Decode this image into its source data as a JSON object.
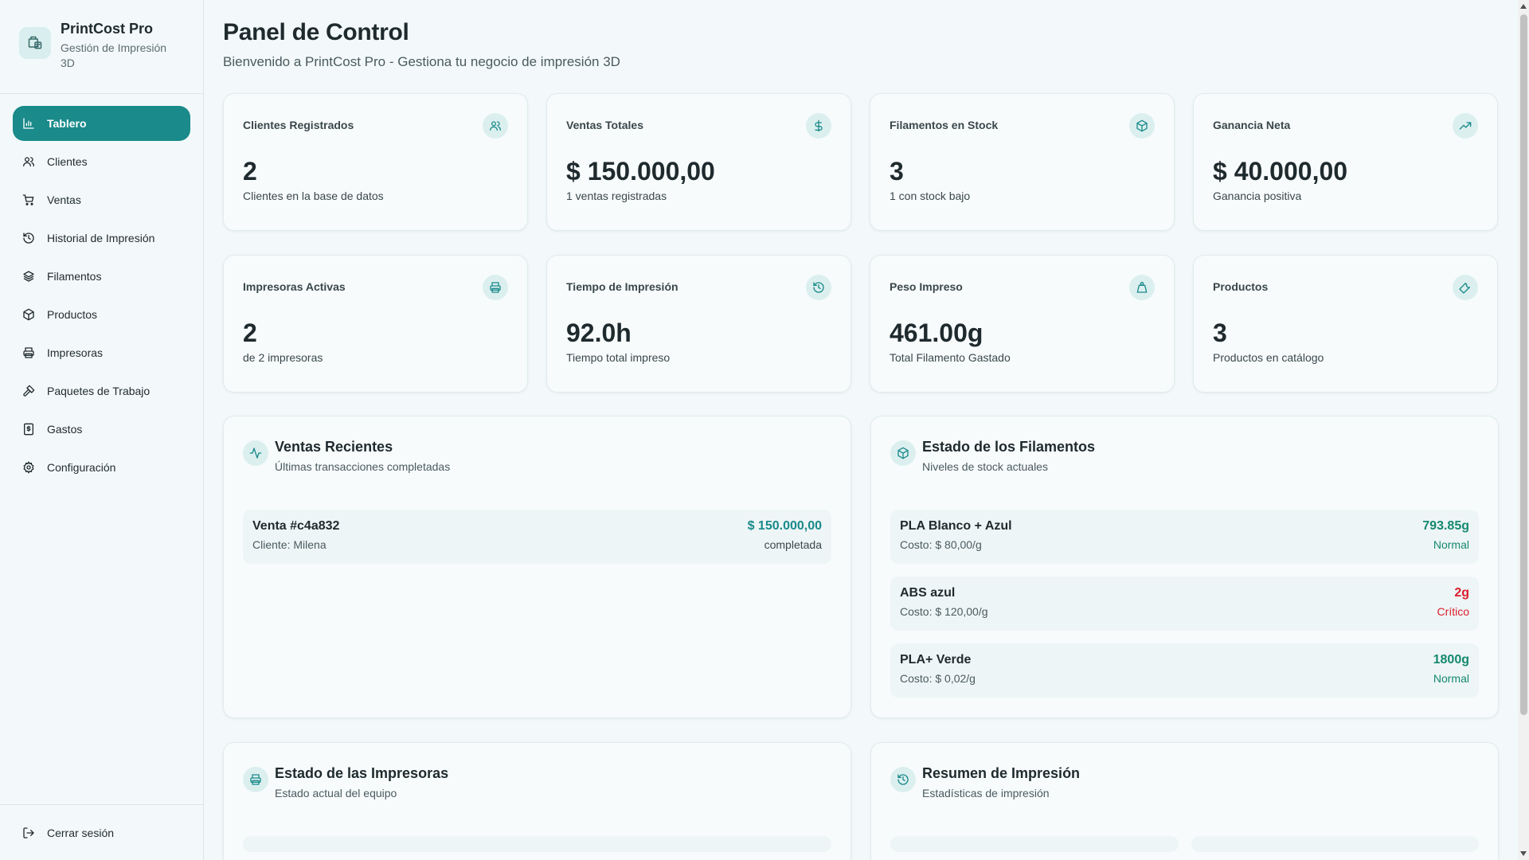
{
  "brand": {
    "title": "PrintCost Pro",
    "subtitle": "Gestión de Impresión 3D"
  },
  "nav": [
    {
      "label": "Tablero",
      "icon": "bar-chart-icon",
      "active": true
    },
    {
      "label": "Clientes",
      "icon": "users-icon"
    },
    {
      "label": "Ventas",
      "icon": "cart-icon"
    },
    {
      "label": "Historial de Impresión",
      "icon": "history-icon"
    },
    {
      "label": "Filamentos",
      "icon": "layers-icon"
    },
    {
      "label": "Productos",
      "icon": "box-icon"
    },
    {
      "label": "Impresoras",
      "icon": "printer-icon"
    },
    {
      "label": "Paquetes de Trabajo",
      "icon": "hammer-icon"
    },
    {
      "label": "Gastos",
      "icon": "receipt-icon"
    },
    {
      "label": "Configuración",
      "icon": "gear-icon"
    }
  ],
  "logout": {
    "label": "Cerrar sesión"
  },
  "header": {
    "title": "Panel de Control",
    "subtitle": "Bienvenido a PrintCost Pro - Gestiona tu negocio de impresión 3D"
  },
  "stats": [
    {
      "label": "Clientes Registrados",
      "value": "2",
      "desc": "Clientes en la base de datos",
      "icon": "users-icon"
    },
    {
      "label": "Ventas Totales",
      "value": "$ 150.000,00",
      "desc": "1 ventas registradas",
      "icon": "dollar-icon"
    },
    {
      "label": "Filamentos en Stock",
      "value": "3",
      "desc": "1 con stock bajo",
      "icon": "box-icon"
    },
    {
      "label": "Ganancia Neta",
      "value": "$ 40.000,00",
      "desc": "Ganancia positiva",
      "icon": "trending-up-icon"
    },
    {
      "label": "Impresoras Activas",
      "value": "2",
      "desc": "de 2 impresoras",
      "icon": "printer-icon"
    },
    {
      "label": "Tiempo de Impresión",
      "value": "92.0h",
      "desc": "Tiempo total impreso",
      "icon": "history-icon"
    },
    {
      "label": "Peso Impreso",
      "value": "461.00g",
      "desc": "Total Filamento Gastado",
      "icon": "weight-icon"
    },
    {
      "label": "Productos",
      "value": "3",
      "desc": "Productos en catálogo",
      "icon": "wrench-icon"
    }
  ],
  "recent_sales": {
    "title": "Ventas Recientes",
    "subtitle": "Últimas transacciones completadas",
    "items": [
      {
        "title": "Venta #c4a832",
        "client": "Cliente: Milena",
        "amount": "$ 150.000,00",
        "status": "completada"
      }
    ]
  },
  "filaments": {
    "title": "Estado de los Filamentos",
    "subtitle": "Niveles de stock actuales",
    "items": [
      {
        "name": "PLA Blanco + Azul",
        "cost": "Costo: $ 80,00/g",
        "amount": "793.85g",
        "status": "Normal",
        "color": "#14886f"
      },
      {
        "name": "ABS azul",
        "cost": "Costo: $ 120,00/g",
        "amount": "2g",
        "status": "Crítico",
        "color": "#d91e2a"
      },
      {
        "name": "PLA+ Verde",
        "cost": "Costo: $ 0,02/g",
        "amount": "1800g",
        "status": "Normal",
        "color": "#14886f"
      }
    ]
  },
  "printers": {
    "title": "Estado de las Impresoras",
    "subtitle": "Estado actual del equipo"
  },
  "summary": {
    "title": "Resumen de Impresión",
    "subtitle": "Estadísticas de impresión"
  },
  "colors": {
    "accent": "#1a8a8a",
    "ok": "#14886f",
    "critical": "#d91e2a",
    "sale_amount": "#1a8a8a"
  }
}
